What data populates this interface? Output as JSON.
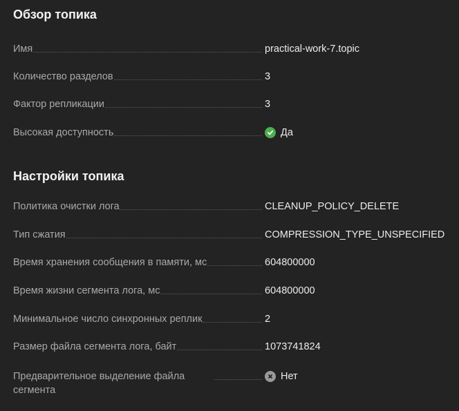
{
  "overview": {
    "title": "Обзор топика",
    "fields": {
      "name": {
        "label": "Имя",
        "value": "practical-work-7.topic"
      },
      "partitions": {
        "label": "Количество разделов",
        "value": "3"
      },
      "replication": {
        "label": "Фактор репликации",
        "value": "3"
      },
      "ha": {
        "label": "Высокая доступность",
        "value": "Да",
        "icon": "check-circle-icon",
        "color": "#4caf50"
      }
    }
  },
  "settings": {
    "title": "Настройки топика",
    "fields": {
      "cleanup": {
        "label": "Политика очистки лога",
        "value": "CLEANUP_POLICY_DELETE"
      },
      "compression": {
        "label": "Тип сжатия",
        "value": "COMPRESSION_TYPE_UNSPECIFIED"
      },
      "retention": {
        "label": "Время хранения сообщения в памяти, мс",
        "value": "604800000"
      },
      "segment_ms": {
        "label": "Время жизни сегмента лога, мс",
        "value": "604800000"
      },
      "min_isr": {
        "label": "Минимальное число синхронных реплик",
        "value": "2"
      },
      "segment_bytes": {
        "label": "Размер файла сегмента лога, байт",
        "value": "1073741824"
      },
      "preallocate": {
        "label": "Предварительное выделение файла сегмента",
        "value": "Нет",
        "icon": "x-circle-icon",
        "color": "#9a9a9a"
      }
    }
  }
}
